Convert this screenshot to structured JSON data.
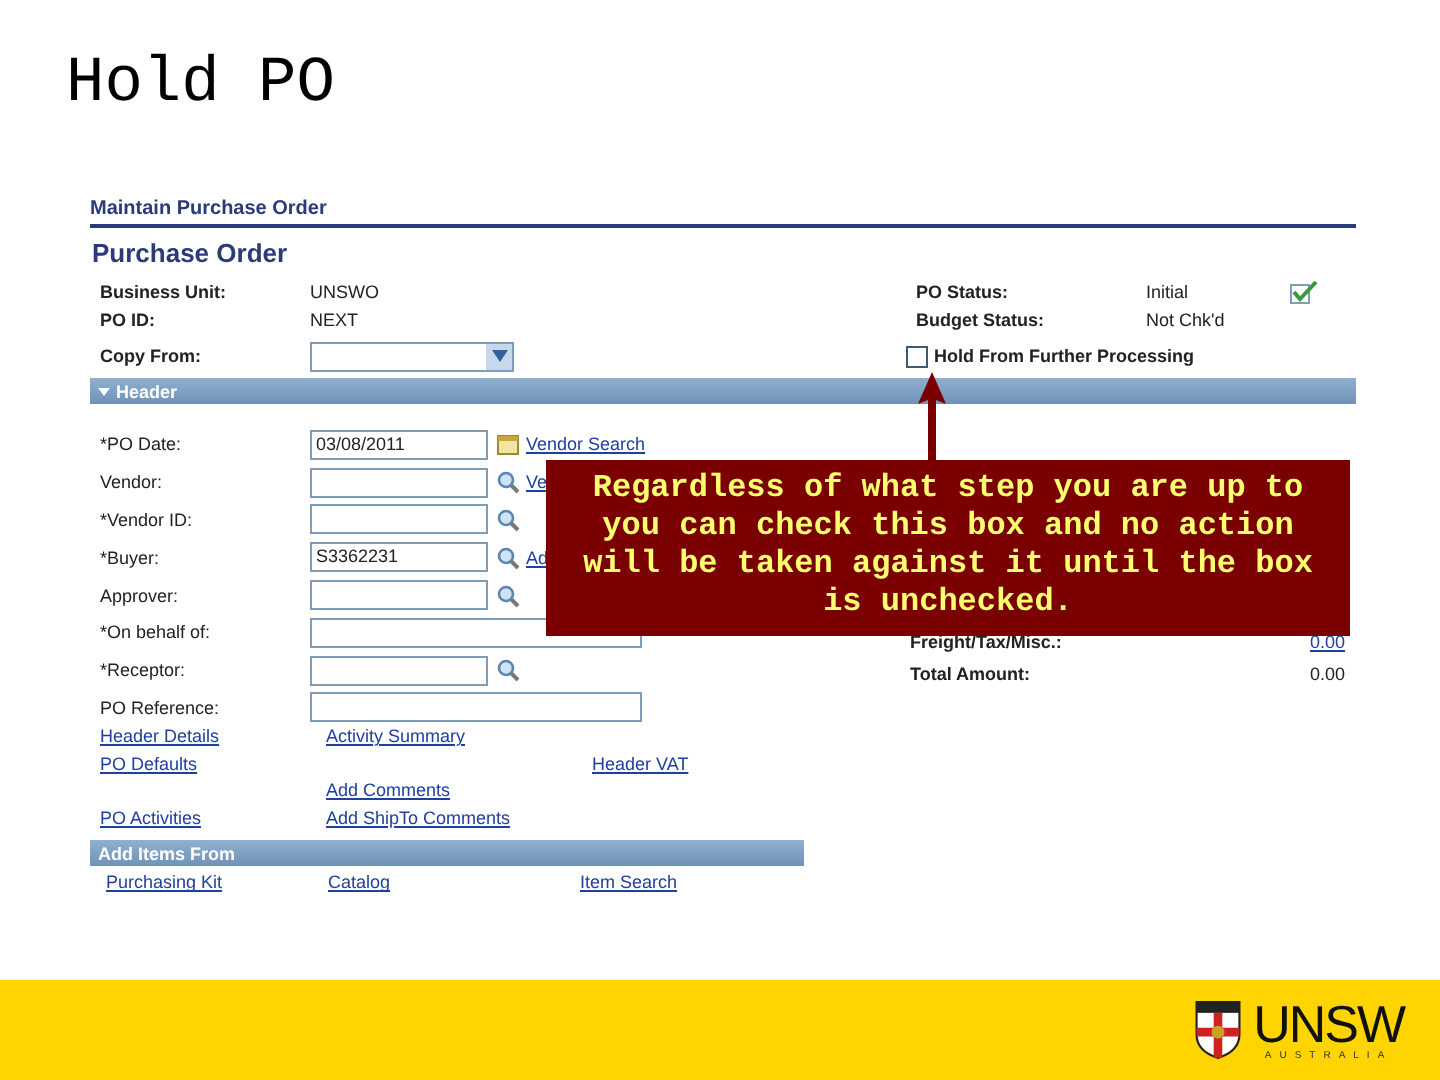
{
  "slide": {
    "title": "Hold PO"
  },
  "page": {
    "breadcrumb": "Maintain Purchase Order",
    "heading": "Purchase Order",
    "summary_rows": [
      {
        "label": "Business Unit:",
        "value": "UNSWO",
        "right_label": "PO Status:",
        "right_value": "Initial"
      },
      {
        "label": "PO ID:",
        "value": "NEXT",
        "right_label": "Budget Status:",
        "right_value": "Not Chk'd"
      }
    ],
    "saved": true,
    "copy_from": {
      "label": "Copy From:"
    },
    "hold": {
      "label": "Hold From Further Processing",
      "checked": false
    },
    "header_section": {
      "title": "Header",
      "expanded": true
    },
    "fields": [
      {
        "label": "*PO Date:",
        "value": "03/08/2011",
        "kind": "date",
        "link": "Vendor Search"
      },
      {
        "label": "Vendor:",
        "kind": "lookup",
        "link": "Ve"
      },
      {
        "label": "*Vendor ID:",
        "kind": "lookup"
      },
      {
        "label": "*Buyer:",
        "value": "S3362231",
        "kind": "lookup",
        "link": "Ad"
      },
      {
        "label": "Approver:",
        "kind": "lookup"
      },
      {
        "label": "*On behalf of:",
        "kind": "wide"
      },
      {
        "label": "*Receptor:",
        "kind": "lookup"
      },
      {
        "label": "PO Reference:",
        "kind": "wide"
      }
    ],
    "totals": [
      {
        "label": "Freight/Tax/Misc.:",
        "value": "0.00",
        "link": true
      },
      {
        "label": "Total Amount:",
        "value": "0.00",
        "link": false
      }
    ],
    "link_rows": [
      {
        "column_1": "Header Details",
        "column_2": "Activity Summary"
      },
      {
        "column_1": "PO Defaults",
        "column_3": "Header VAT"
      },
      {
        "column_2": "Add Comments"
      },
      {
        "column_1": "PO Activities",
        "column_2": "Add ShipTo Comments"
      }
    ],
    "add_items": {
      "title": "Add Items From",
      "options": [
        "Purchasing Kit",
        "Catalog",
        "Item Search"
      ]
    }
  },
  "callout": {
    "text": "Regardless of what step you are up to you can check this box and no action will be taken against it until the box is unchecked."
  },
  "footer": {
    "logo": "UNSW",
    "logo_sub": "AUSTRALIA"
  }
}
